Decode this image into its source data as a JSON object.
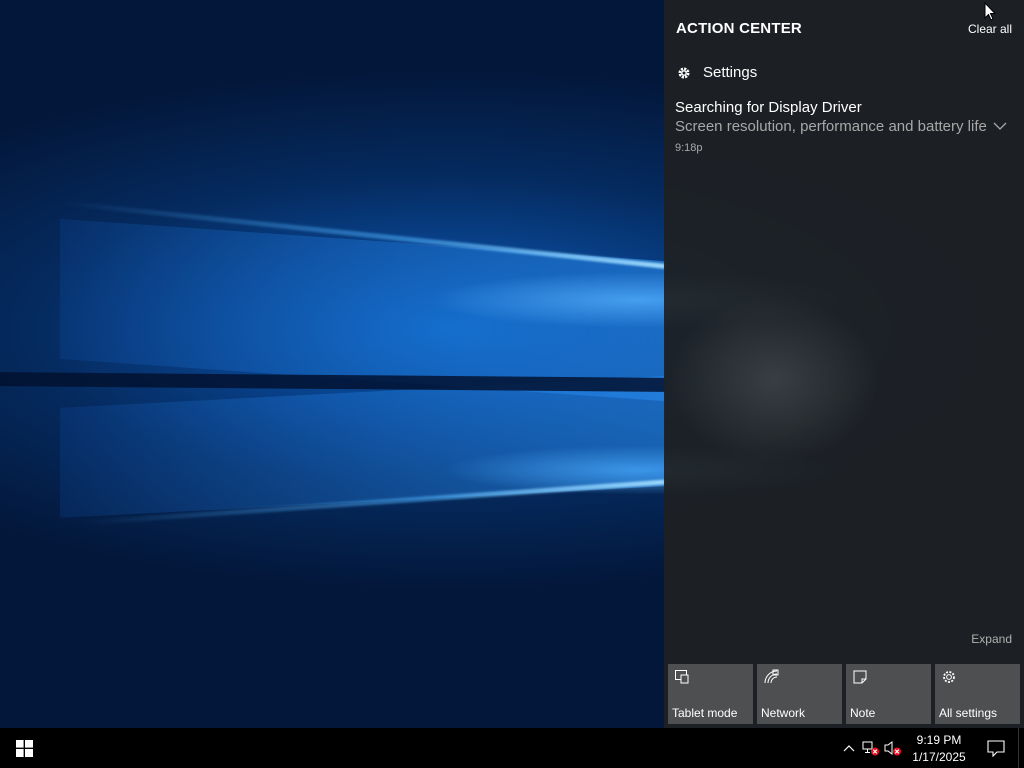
{
  "action_center": {
    "title": "ACTION CENTER",
    "clear_all": "Clear all",
    "group": {
      "icon": "gear-icon",
      "name": "Settings"
    },
    "notification": {
      "title": "Searching for Display Driver",
      "body": "Screen resolution, performance and battery life",
      "time": "9:18p",
      "expand_icon": "chevron-down-icon"
    },
    "expand_label": "Expand",
    "quick_actions": [
      {
        "label": "Tablet mode",
        "icon": "tablet-mode-icon"
      },
      {
        "label": "Network",
        "icon": "network-icon"
      },
      {
        "label": "Note",
        "icon": "note-icon"
      },
      {
        "label": "All settings",
        "icon": "gear-icon"
      }
    ]
  },
  "taskbar": {
    "start_icon": "windows-logo-icon",
    "tray_icons": [
      "chevron-up-icon",
      "network-disconnected-icon",
      "volume-muted-icon"
    ],
    "clock": {
      "time": "9:19 PM",
      "date": "1/17/2025"
    },
    "notification_icon": "action-center-icon"
  },
  "colors": {
    "desktop_accent": "#0a5db8",
    "panel_bg": "#1e2022",
    "tile_bg": "#4d4f51",
    "muted_text": "#a8a8a8"
  }
}
